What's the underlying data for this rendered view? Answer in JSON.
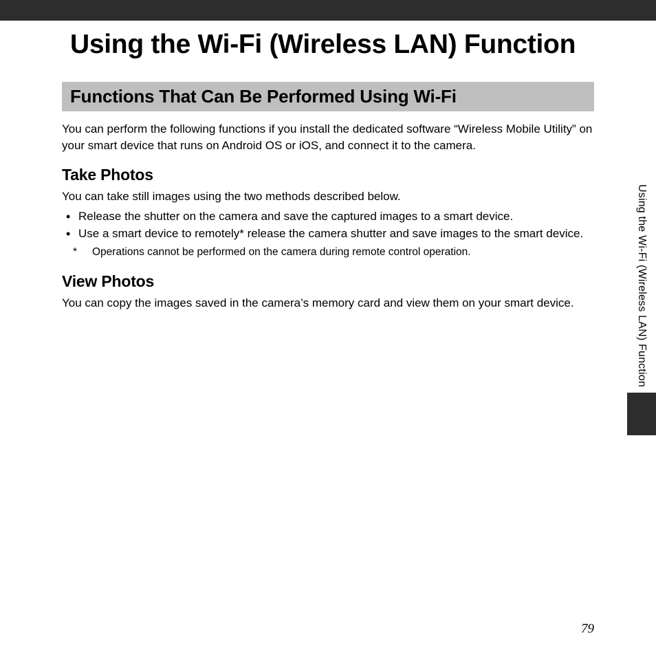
{
  "header": {
    "main_title": "Using the Wi-Fi (Wireless LAN) Function"
  },
  "section": {
    "heading": "Functions That Can Be Performed Using Wi-Fi",
    "intro": "You can perform the following functions if you install the dedicated software “Wireless Mobile Utility” on your smart device that runs on Android OS or iOS, and connect it to the camera."
  },
  "take_photos": {
    "heading": "Take Photos",
    "text": "You can take still images using the two methods described below.",
    "bullets": [
      "Release the shutter on the camera and save the captured images to a smart device.",
      "Use a smart device to remotely* release the camera shutter and save images to the smart device."
    ],
    "footnote_mark": "*",
    "footnote": "Operations cannot be performed on the camera during remote control operation."
  },
  "view_photos": {
    "heading": "View Photos",
    "text": "You can copy the images saved in the camera’s memory card and view them on your smart device."
  },
  "side_tab": {
    "label": "Using the Wi-Fi (Wireless LAN) Function"
  },
  "page_number": "79"
}
